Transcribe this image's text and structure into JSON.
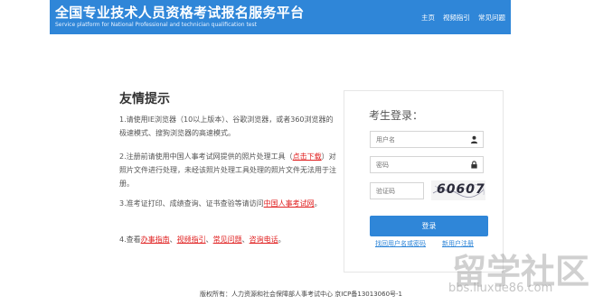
{
  "header": {
    "title": "全国专业技术人员资格考试报名服务平台",
    "subtitle": "Service platform for National Professional and technician qualification test",
    "nav": [
      "主页",
      "视频指引",
      "常见问题"
    ]
  },
  "tips": {
    "title": "友情提示",
    "item1": "1.请使用IE浏览器（10以上版本）、谷歌浏览器，或者360浏览器的极速模式、搜狗浏览器的高速模式。",
    "item2_pre": "2.注册前请使用中国人事考试网提供的照片处理工具（",
    "item2_link": "点击下载",
    "item2_post": "）对照片文件进行处理，未经该照片处理工具处理的照片文件无法用于注册。",
    "item3_pre": "3.准考证打印、成绩查询、证书查验等请访问",
    "item3_link": "中国人事考试网",
    "item3_post": "。",
    "item4_pre": "4.查看",
    "item4_links": [
      "办事指南",
      "视频指引",
      "常见问题",
      "咨询电话"
    ],
    "item4_sep": "、",
    "item4_post": "。"
  },
  "login": {
    "title": "考生登录：",
    "username_placeholder": "用户名",
    "password_placeholder": "密码",
    "captcha_placeholder": "验证码",
    "captcha_value": "60607",
    "submit_label": "登录",
    "recover_link": "找回用户名或密码",
    "register_link": "新用户注册"
  },
  "footer": {
    "copyright": "版权所有：人力资源和社会保障部人事考试中心 京ICP备13013060号-1"
  },
  "watermark": {
    "text": "留学社区",
    "url": "bbs.liuxue86.com"
  },
  "colors": {
    "primary": "#2f86d8",
    "link_red": "#e02020"
  }
}
